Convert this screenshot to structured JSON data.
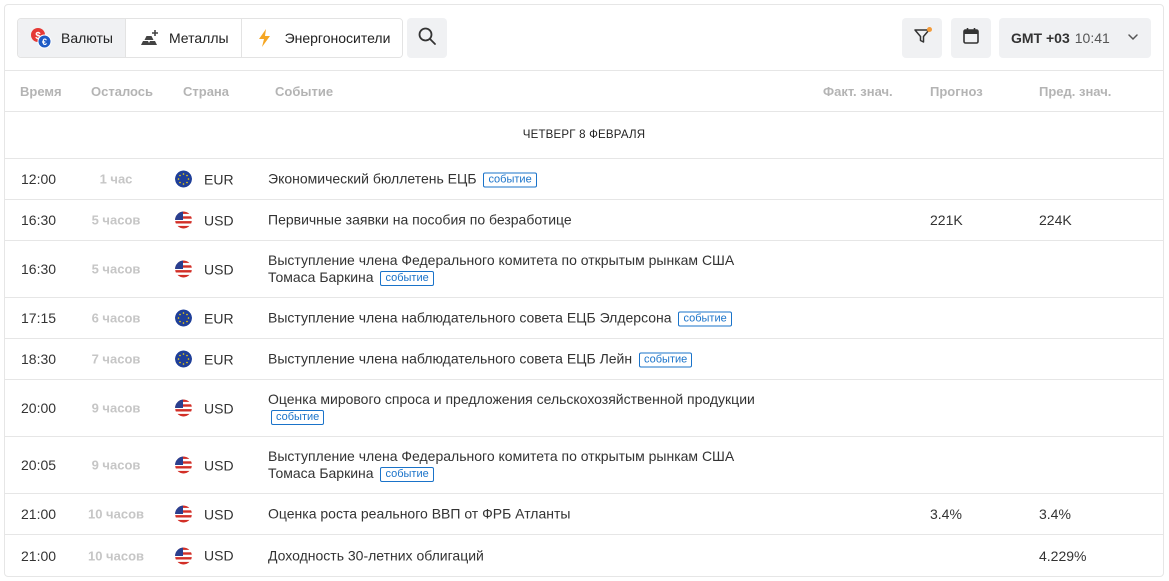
{
  "toolbar": {
    "tabs": [
      {
        "label": "Валюты",
        "icon": "currency-icon",
        "active": true
      },
      {
        "label": "Металлы",
        "icon": "metal-bars-icon",
        "active": false
      },
      {
        "label": "Энергоносители",
        "icon": "lightning-icon",
        "active": false
      }
    ],
    "timezone": {
      "zone": "GMT +03",
      "time": "10:41"
    },
    "accent_dot_color": "#f39b3a"
  },
  "columns": {
    "time": "Время",
    "left": "Осталось",
    "country": "Страна",
    "event": "Событие",
    "fact": "Факт. знач.",
    "forecast": "Прогноз",
    "prev": "Пред. знач."
  },
  "day_header": "ЧЕТВЕРГ 8 ФЕВРАЛЯ",
  "tag_color": "#1a73c9",
  "events": [
    {
      "time": "12:00",
      "left": "1 час",
      "country": "EUR",
      "event": "Экономический бюллетень ЕЦБ",
      "tag": "событие",
      "fact": "",
      "forecast": "",
      "prev": ""
    },
    {
      "time": "16:30",
      "left": "5 часов",
      "country": "USD",
      "event": "Первичные заявки на пособия по безработице",
      "tag": "",
      "fact": "",
      "forecast": "221K",
      "prev": "224K"
    },
    {
      "time": "16:30",
      "left": "5 часов",
      "country": "USD",
      "event": "Выступление члена Федерального комитета по открытым рынкам США Томаса Баркина",
      "tag": "событие",
      "fact": "",
      "forecast": "",
      "prev": ""
    },
    {
      "time": "17:15",
      "left": "6 часов",
      "country": "EUR",
      "event": "Выступление члена наблюдательного совета ЕЦБ Элдерсона",
      "tag": "событие",
      "fact": "",
      "forecast": "",
      "prev": ""
    },
    {
      "time": "18:30",
      "left": "7 часов",
      "country": "EUR",
      "event": "Выступление члена наблюдательного совета ЕЦБ Лейн",
      "tag": "событие",
      "fact": "",
      "forecast": "",
      "prev": ""
    },
    {
      "time": "20:00",
      "left": "9 часов",
      "country": "USD",
      "event": "Оценка мирового спроса и предложения сельскохозяйственной продукции",
      "tag": "событие",
      "fact": "",
      "forecast": "",
      "prev": ""
    },
    {
      "time": "20:05",
      "left": "9 часов",
      "country": "USD",
      "event": "Выступление члена Федерального комитета по открытым рынкам США Томаса Баркина",
      "tag": "событие",
      "fact": "",
      "forecast": "",
      "prev": ""
    },
    {
      "time": "21:00",
      "left": "10 часов",
      "country": "USD",
      "event": "Оценка роста реального ВВП от ФРБ Атланты",
      "tag": "",
      "fact": "",
      "forecast": "3.4%",
      "prev": "3.4%"
    },
    {
      "time": "21:00",
      "left": "10 часов",
      "country": "USD",
      "event": "Доходность 30-летних облигаций",
      "tag": "",
      "fact": "",
      "forecast": "",
      "prev": "4.229%"
    }
  ]
}
